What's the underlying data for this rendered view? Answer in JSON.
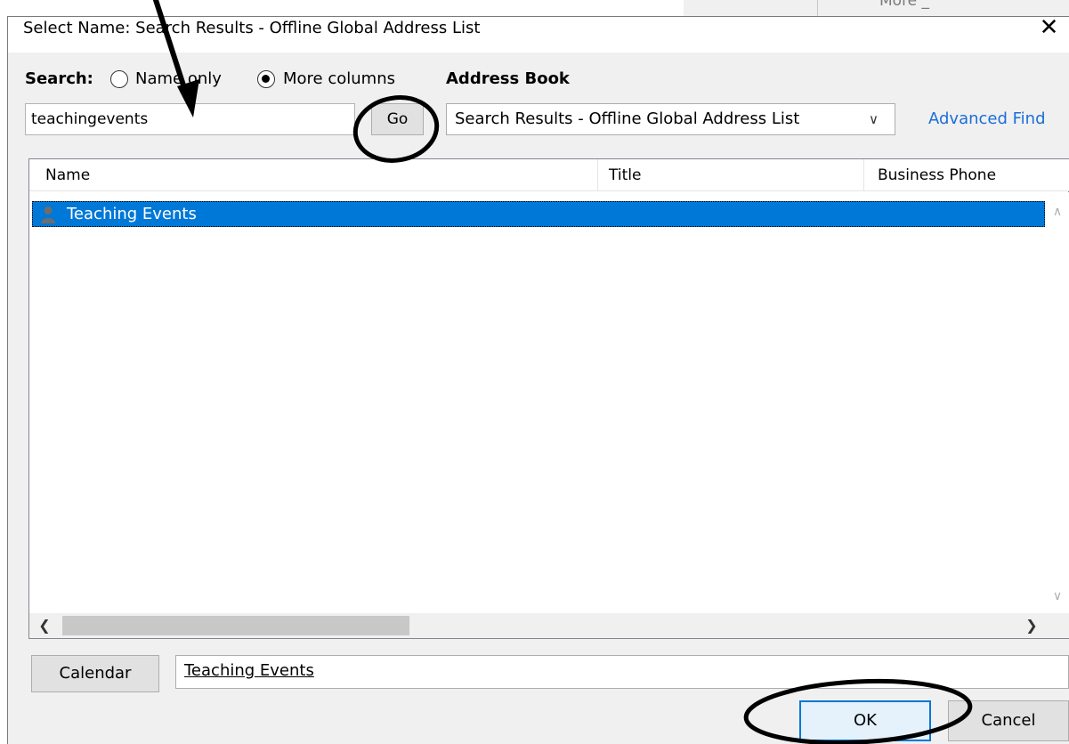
{
  "background_window": {
    "partial_text": "More _"
  },
  "dialog": {
    "title": "Select Name: Search Results - Offline Global Address List",
    "close_label": "✕"
  },
  "search": {
    "label": "Search:",
    "option_name_only": "Name only",
    "option_more_columns": "More columns",
    "selected_option": "More columns",
    "query": "teachingevents",
    "go_label": "Go"
  },
  "address_book": {
    "label": "Address Book",
    "selected": "Search Results - Offline Global Address List",
    "advanced_find": "Advanced Find"
  },
  "results": {
    "columns": [
      "Name",
      "Title",
      "Business Phone"
    ],
    "rows": [
      {
        "name": "Teaching Events",
        "icon": "person-icon",
        "selected": true
      }
    ]
  },
  "bottom": {
    "field_button": "Calendar",
    "field_value": "Teaching Events",
    "ok_label": "OK",
    "cancel_label": "Cancel"
  },
  "colors": {
    "selection": "#0078d7",
    "link": "#1a6ed8",
    "annotation": "#000000"
  }
}
